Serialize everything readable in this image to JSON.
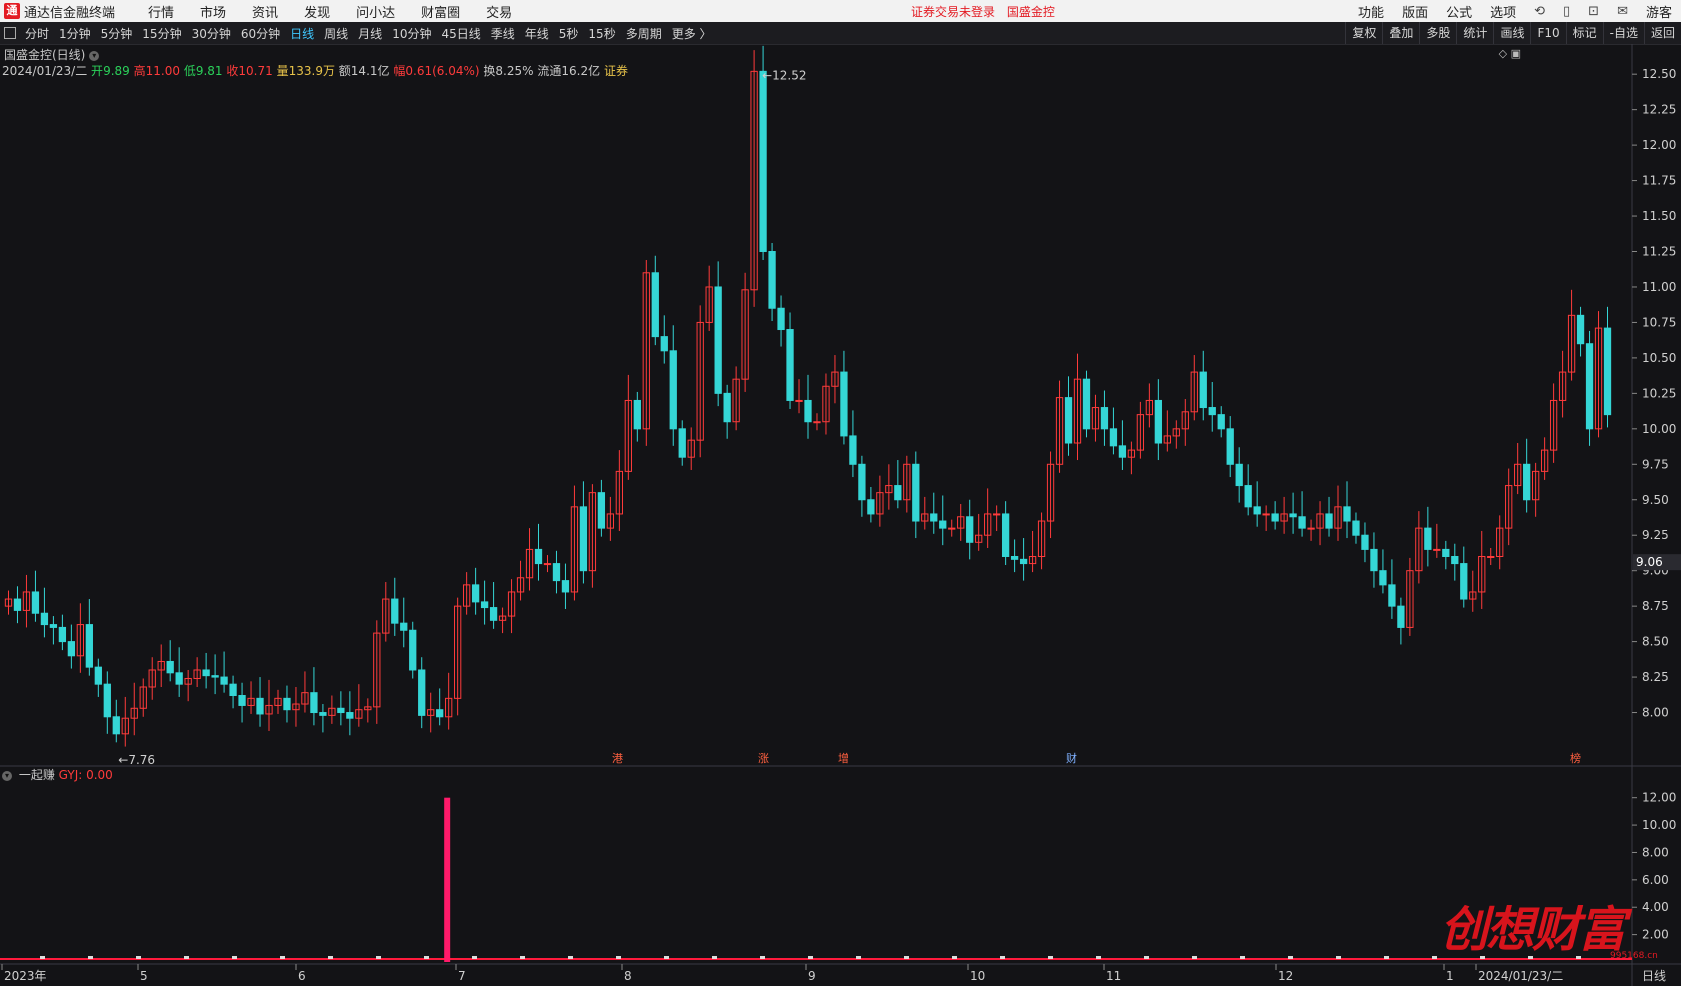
{
  "app": {
    "title": "通达信金融终端",
    "logo_letter": "通"
  },
  "menu": [
    "行情",
    "市场",
    "资讯",
    "发现",
    "问小达",
    "财富圈",
    "交易"
  ],
  "notice": {
    "text1": "证券交易未登录",
    "text2": "国盛金控"
  },
  "right_menu": [
    "功能",
    "版面",
    "公式",
    "选项",
    "游客"
  ],
  "periods": [
    "分时",
    "1分钟",
    "5分钟",
    "15分钟",
    "30分钟",
    "60分钟",
    "日线",
    "周线",
    "月线",
    "10分钟",
    "45日线",
    "季线",
    "年线",
    "5秒",
    "15秒",
    "多周期",
    "更多 〉"
  ],
  "active_period": "日线",
  "tools": [
    "复权",
    "叠加",
    "多股",
    "统计",
    "画线",
    "F10",
    "标记",
    "-自选",
    "返回"
  ],
  "stock": {
    "name_line": "国盛金控(日线)",
    "date": "2024/01/23/二",
    "open_label": "开",
    "open": "9.89",
    "high_label": "高",
    "high": "11.00",
    "low_label": "低",
    "low": "9.81",
    "close_label": "收",
    "close": "10.71",
    "vol_label": "量",
    "vol": "133.9万",
    "amt_label": "额",
    "amt": "14.1亿",
    "chg_label": "幅",
    "chg": "0.61(6.04%)",
    "turn_label": "换",
    "turn": "8.25%",
    "float_label": "流通",
    "float": "16.2亿",
    "sector": "证券"
  },
  "colors": {
    "up": "#ff3b3b",
    "down": "#35d6d6",
    "accent": "#3fc8ff",
    "bg": "#131316",
    "grid": "#2a2a30"
  },
  "chart_data": [
    {
      "type": "candlestick",
      "title": "国盛金控(日线)",
      "ylim": [
        7.75,
        12.6
      ],
      "yticks": [
        8.0,
        8.25,
        8.5,
        8.75,
        9.0,
        9.25,
        9.5,
        9.75,
        10.0,
        10.25,
        10.5,
        10.75,
        11.0,
        11.25,
        11.5,
        11.75,
        12.0,
        12.25,
        12.5
      ],
      "current_price": "9.06",
      "max_label": "12.52",
      "min_label": "7.76",
      "x_month_labels": [
        "2023年",
        "5",
        "6",
        "7",
        "8",
        "9",
        "10",
        "11",
        "12",
        "1",
        "2024/01/23/二"
      ],
      "period_label": "日线",
      "event_markers": [
        "港",
        "涨",
        "增",
        "财",
        "榜"
      ],
      "close_series": [
        8.8,
        8.72,
        8.85,
        8.7,
        8.62,
        8.6,
        8.5,
        8.4,
        8.62,
        8.32,
        8.2,
        7.97,
        7.85,
        7.96,
        8.03,
        8.18,
        8.3,
        8.36,
        8.28,
        8.2,
        8.24,
        8.3,
        8.26,
        8.25,
        8.2,
        8.12,
        8.05,
        8.1,
        7.99,
        8.05,
        8.1,
        8.02,
        8.06,
        8.14,
        8.0,
        7.98,
        8.03,
        8.0,
        7.96,
        8.02,
        8.04,
        8.56,
        8.8,
        8.63,
        8.58,
        8.3,
        7.98,
        8.02,
        7.97,
        8.1,
        8.75,
        8.9,
        8.78,
        8.74,
        8.65,
        8.68,
        8.85,
        8.95,
        9.15,
        9.05,
        9.05,
        8.93,
        8.85,
        9.45,
        9.0,
        9.55,
        9.3,
        9.4,
        9.7,
        10.2,
        10.0,
        11.1,
        10.65,
        10.55,
        10.0,
        9.8,
        9.92,
        10.75,
        11.0,
        10.25,
        10.05,
        10.35,
        10.98,
        12.52,
        11.25,
        10.85,
        10.7,
        10.2,
        10.2,
        10.05,
        10.05,
        10.3,
        10.4,
        9.95,
        9.75,
        9.5,
        9.4,
        9.55,
        9.6,
        9.5,
        9.75,
        9.35,
        9.4,
        9.35,
        9.3,
        9.3,
        9.38,
        9.2,
        9.25,
        9.4,
        9.4,
        9.1,
        9.08,
        9.05,
        9.1,
        9.35,
        9.75,
        10.22,
        9.9,
        10.35,
        10.0,
        10.15,
        10.0,
        9.88,
        9.8,
        9.85,
        10.1,
        10.2,
        9.9,
        9.95,
        10.0,
        10.12,
        10.4,
        10.15,
        10.1,
        10.0,
        9.75,
        9.6,
        9.45,
        9.4,
        9.4,
        9.35,
        9.4,
        9.38,
        9.3,
        9.3,
        9.4,
        9.3,
        9.45,
        9.35,
        9.25,
        9.15,
        9.0,
        8.9,
        8.75,
        8.6,
        9.0,
        9.3,
        9.15,
        9.15,
        9.1,
        9.05,
        8.8,
        8.85,
        9.1,
        9.1,
        9.3,
        9.6,
        9.75,
        9.5,
        9.7,
        9.85,
        10.2,
        10.4,
        10.8,
        10.6,
        10.0,
        10.71,
        10.1
      ]
    },
    {
      "type": "bar",
      "title": "一起赚",
      "indicator_label": "GYJ: 0.00",
      "ylim": [
        0,
        13
      ],
      "yticks": [
        2.0,
        4.0,
        6.0,
        8.0,
        10.0,
        12.0
      ],
      "spike_value": 12.0
    }
  ],
  "watermark": {
    "text": "创想财富",
    "url": "995168.cn"
  }
}
